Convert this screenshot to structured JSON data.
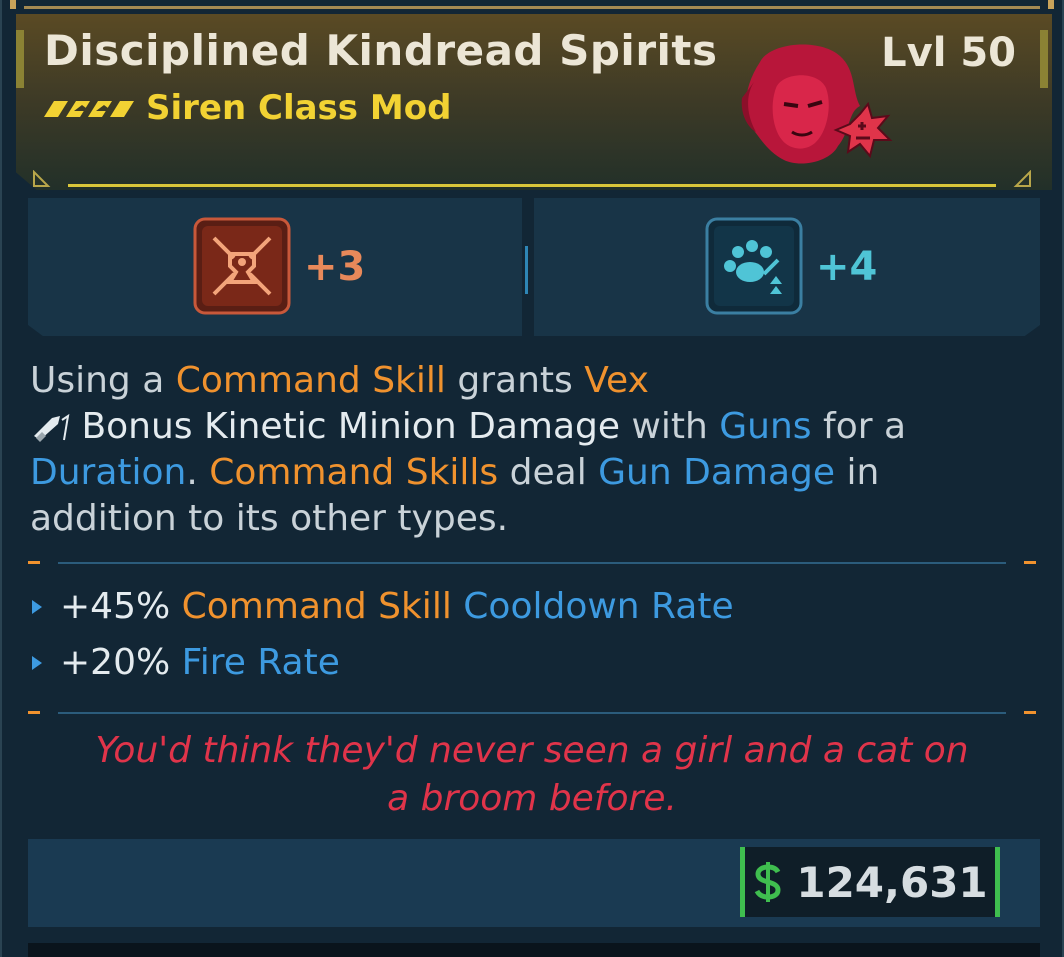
{
  "item": {
    "name": "Disciplined Kindread Spirits",
    "level": "Lvl 50",
    "class": "Siren Class Mod",
    "rarity_icon": "legendary-chevrons-icon",
    "portrait_icon": "vex-portrait-icon"
  },
  "skills": [
    {
      "icon": "command-skill-icon",
      "value": "+3",
      "color": "#e8895a"
    },
    {
      "icon": "minion-paw-icon",
      "value": "+4",
      "color": "#4fc4d6"
    }
  ],
  "description": {
    "p1": "Using a ",
    "p2": "Command Skill",
    "p3": " grants ",
    "p4": "Vex",
    "p5": " Bonus Kinetic Minion Damage",
    "p6": " with ",
    "p7": "Guns",
    "p8": " for a ",
    "p9": "Duration",
    "p10": ". ",
    "p11": "Command Skills",
    "p12": " deal ",
    "p13": "Gun Damage",
    "p14": " in addition to its other types."
  },
  "stats": [
    {
      "value": "+45%",
      "part1": "Command Skill",
      "part2": "Cooldown Rate"
    },
    {
      "value": "+20%",
      "part1": "",
      "part2": "Fire Rate"
    }
  ],
  "flavor_text": "You'd think they'd never seen a girl and a cat on a broom before.",
  "price": {
    "currency_icon": "dollar-icon",
    "value": "124,631"
  },
  "colors": {
    "orange": "#f0922e",
    "blue": "#3d9ae0",
    "legendary_yellow": "#f2d233",
    "flavor_red": "#e0344a",
    "price_green": "#3fbe4f"
  }
}
